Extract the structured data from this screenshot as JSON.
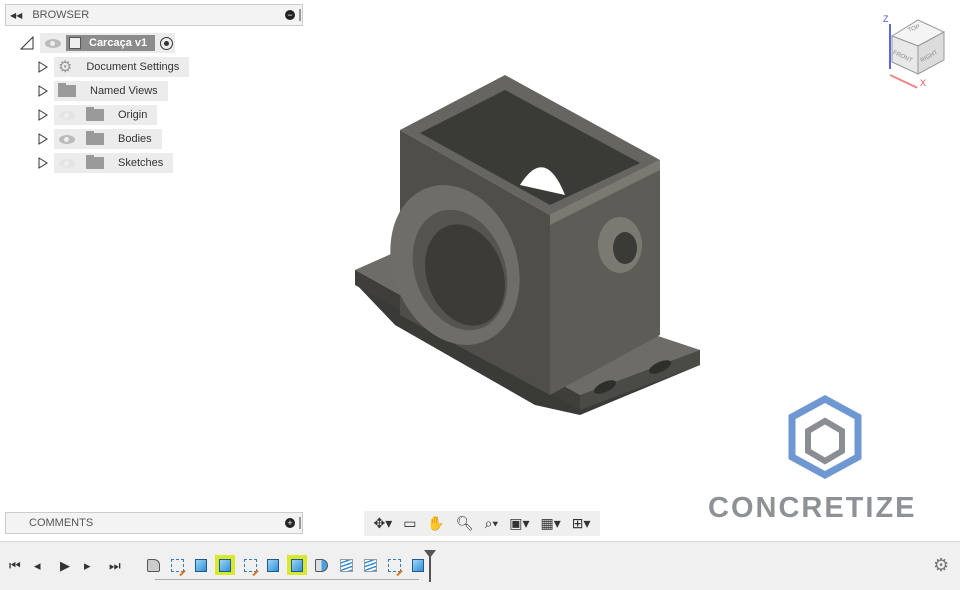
{
  "browser": {
    "title": "BROWSER",
    "root": {
      "label": "Carcaça v1"
    },
    "items": [
      {
        "label": "Document Settings",
        "icon": "gear-icon"
      },
      {
        "label": "Named Views",
        "icon": "folder-icon"
      },
      {
        "label": "Origin",
        "icon": "folder-icon",
        "visible": false
      },
      {
        "label": "Bodies",
        "icon": "folder-icon",
        "visible": true
      },
      {
        "label": "Sketches",
        "icon": "folder-icon",
        "visible": false
      }
    ]
  },
  "comments": {
    "title": "COMMENTS"
  },
  "viewcube": {
    "top": "TOP",
    "front": "FRONT",
    "right": "RIGHT",
    "axis_z": "Z",
    "axis_x": "X"
  },
  "watermark": {
    "text": "CONCRETIZE"
  },
  "navbar": [
    "orbit",
    "look-at",
    "pan",
    "zoom",
    "zoom-window",
    "display-settings",
    "grid-settings",
    "viewports"
  ],
  "timeline": {
    "features": [
      "form",
      "sketch",
      "extrude",
      "extrude",
      "sketch",
      "extrude",
      "extrude",
      "revolve",
      "thread",
      "thread",
      "sketch",
      "extrude"
    ],
    "highlighted": [
      3,
      6
    ]
  }
}
